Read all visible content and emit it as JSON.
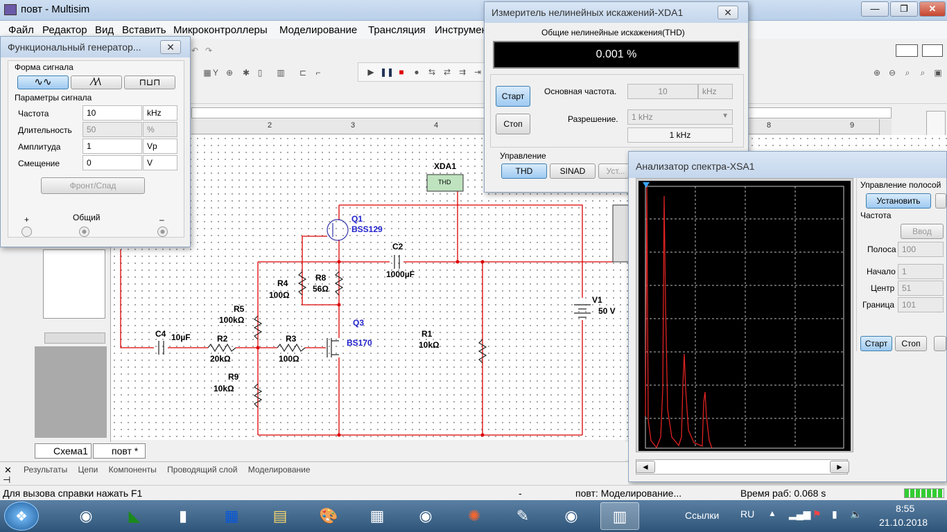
{
  "window": {
    "title": "повт - Multisim",
    "minimize": "—",
    "maximize": "❐",
    "close": "✕"
  },
  "menu": [
    "Файл",
    "Редактор",
    "Вид",
    "Вставить",
    "Микроконтроллеры",
    "Моделирование",
    "Трансляция",
    "Инструмент"
  ],
  "ruler": [
    "2",
    "3",
    "4",
    "8",
    "9"
  ],
  "fgen": {
    "title": "Функциональный генератор...",
    "waveform_label": "Форма сигнала",
    "params_label": "Параметры сигнала",
    "rows": [
      {
        "label": "Частота",
        "value": "10",
        "unit": "kHz"
      },
      {
        "label": "Длительность",
        "value": "50",
        "unit": "%"
      },
      {
        "label": "Амплитуда",
        "value": "1",
        "unit": "Vp"
      },
      {
        "label": "Смещение",
        "value": "0",
        "unit": "V"
      }
    ],
    "rise_fall": "Фронт/Спад",
    "plus": "+",
    "common": "Общий",
    "minus": "–"
  },
  "xda": {
    "title": "Измеритель нелинейных искажений-XDA1",
    "thd_label": "Общие нелинейные искажения(THD)",
    "thd_value": "0.001 %",
    "start": "Старт",
    "stop": "Стоп",
    "freq_label": "Основная частота.",
    "freq_value": "10",
    "freq_unit": "kHz",
    "res_label": "Разрешение.",
    "res_value": "1 kHz",
    "res_display": "1 kHz",
    "control_label": "Управление",
    "modes": [
      "THD",
      "SINAD",
      "Уст..."
    ]
  },
  "xsa": {
    "title": "Анализатор спектра-XSA1",
    "band_ctrl": "Управление полосой",
    "set_btn": "Установить",
    "freq_label": "Частота",
    "enter_btn": "Ввод",
    "fields": [
      {
        "label": "Полоса",
        "value": "100"
      },
      {
        "label": "Начало",
        "value": "1"
      },
      {
        "label": "Центр",
        "value": "51"
      },
      {
        "label": "Граница",
        "value": "101"
      }
    ],
    "start": "Старт",
    "stop": "Стоп"
  },
  "schematic": {
    "xda_ref": "XDA1",
    "xda_inner": "THD",
    "q1": "Q1",
    "q1_model": "BSS129",
    "c2": "C2",
    "c2_val": "1000µF",
    "r4": "R4",
    "r4_val": "100Ω",
    "r8": "R8",
    "r8_val": "56Ω",
    "r5": "R5",
    "r5_val": "100kΩ",
    "q3": "Q3",
    "q3_model": "BS170",
    "c4": "C4",
    "c4_val": "10µF",
    "r2": "R2",
    "r2_val": "20kΩ",
    "r3": "R3",
    "r3_val": "100Ω",
    "r9": "R9",
    "r9_val": "10kΩ",
    "r1": "R1",
    "r1_val": "10kΩ",
    "v1": "V1",
    "v1_val": "50 V"
  },
  "tabs": [
    "Схема1",
    "повт *"
  ],
  "bottom_tabs": [
    "Результаты",
    "Цепи",
    "Компоненты",
    "Проводящий слой",
    "Моделирование"
  ],
  "status": {
    "help": "Для вызова справки нажать F1",
    "dash": "-",
    "sim": "повт: Моделирование...",
    "time": "Время раб: 0.068 s"
  },
  "taskbar": {
    "links": "Ссылки",
    "lang": "RU",
    "time": "8:55",
    "date": "21.10.2018"
  }
}
